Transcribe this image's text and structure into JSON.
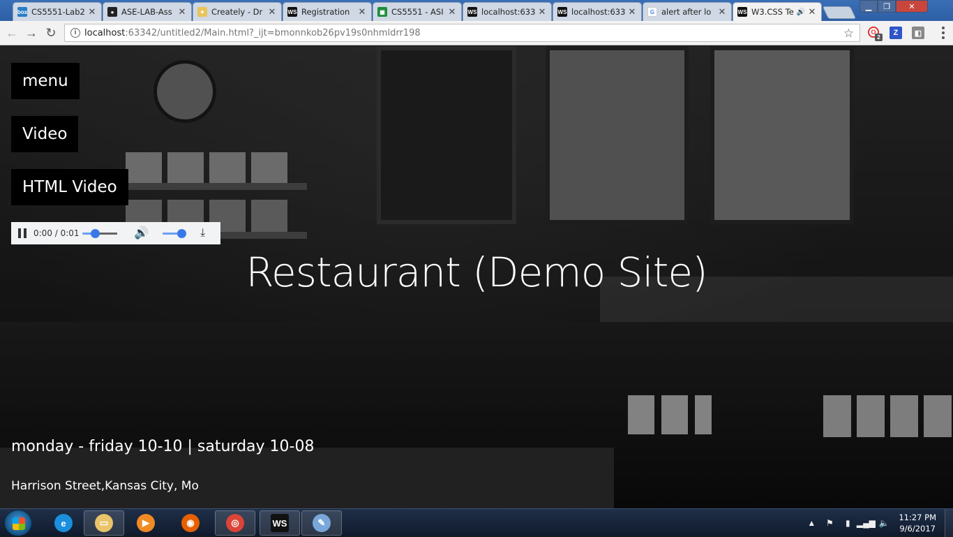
{
  "browser": {
    "tabs": [
      {
        "label": "CS5551-Lab2",
        "favicon": "box-icon",
        "color": "#2a7dc7",
        "glyph": "box"
      },
      {
        "label": "ASE-LAB-Ass",
        "favicon": "github-icon",
        "color": "#222222",
        "glyph": "●"
      },
      {
        "label": "Creately - Dr",
        "favicon": "lightbulb-icon",
        "color": "#e8c45a",
        "glyph": "✦"
      },
      {
        "label": "Registration",
        "favicon": "webstorm-icon",
        "color": "#111111",
        "glyph": "WS"
      },
      {
        "label": "CS5551 - ASI",
        "favicon": "sheets-icon",
        "color": "#1e8e3e",
        "glyph": "▦"
      },
      {
        "label": "localhost:633",
        "favicon": "webstorm-icon",
        "color": "#111111",
        "glyph": "WS"
      },
      {
        "label": "localhost:633",
        "favicon": "webstorm-icon",
        "color": "#111111",
        "glyph": "WS"
      },
      {
        "label": "alert after lo",
        "favicon": "google-icon",
        "color": "#ffffff",
        "glyph": "G"
      },
      {
        "label": "W3.CSS Te",
        "favicon": "webstorm-icon",
        "color": "#111111",
        "glyph": "WS",
        "active": true,
        "audio": true
      }
    ],
    "close_glyph": "✕",
    "url_host": "localhost",
    "url_path": ":63342/untitled2/Main.html?_ijt=bmonnkob26pv19s0nhmldrr198",
    "extension_badge": "2"
  },
  "page": {
    "nav": [
      "menu",
      "Video",
      "HTML Video"
    ],
    "audio": {
      "time": "0:00 / 0:01",
      "progress": 0.35,
      "volume": 0.9
    },
    "title": "Restaurant (Demo Site)",
    "hours": "monday - friday 10-10 | saturday 10-08",
    "address": "Harrison Street,Kansas City, Mo"
  },
  "taskbar": {
    "apps": [
      {
        "name": "internet-explorer-icon",
        "color": "#1b8ede",
        "glyph": "e"
      },
      {
        "name": "file-explorer-icon",
        "color": "#e9c46a",
        "glyph": "▭"
      },
      {
        "name": "media-player-icon",
        "color": "#f08a24",
        "glyph": "▶"
      },
      {
        "name": "firefox-icon",
        "color": "#e66000",
        "glyph": "◉"
      },
      {
        "name": "chrome-icon",
        "color": "#db4437",
        "glyph": "◎"
      },
      {
        "name": "webstorm-icon",
        "color": "#111111",
        "glyph": "WS"
      },
      {
        "name": "paint-icon",
        "color": "#7aa7d9",
        "glyph": "✎"
      }
    ],
    "clock_time": "11:27 PM",
    "clock_date": "9/6/2017"
  }
}
